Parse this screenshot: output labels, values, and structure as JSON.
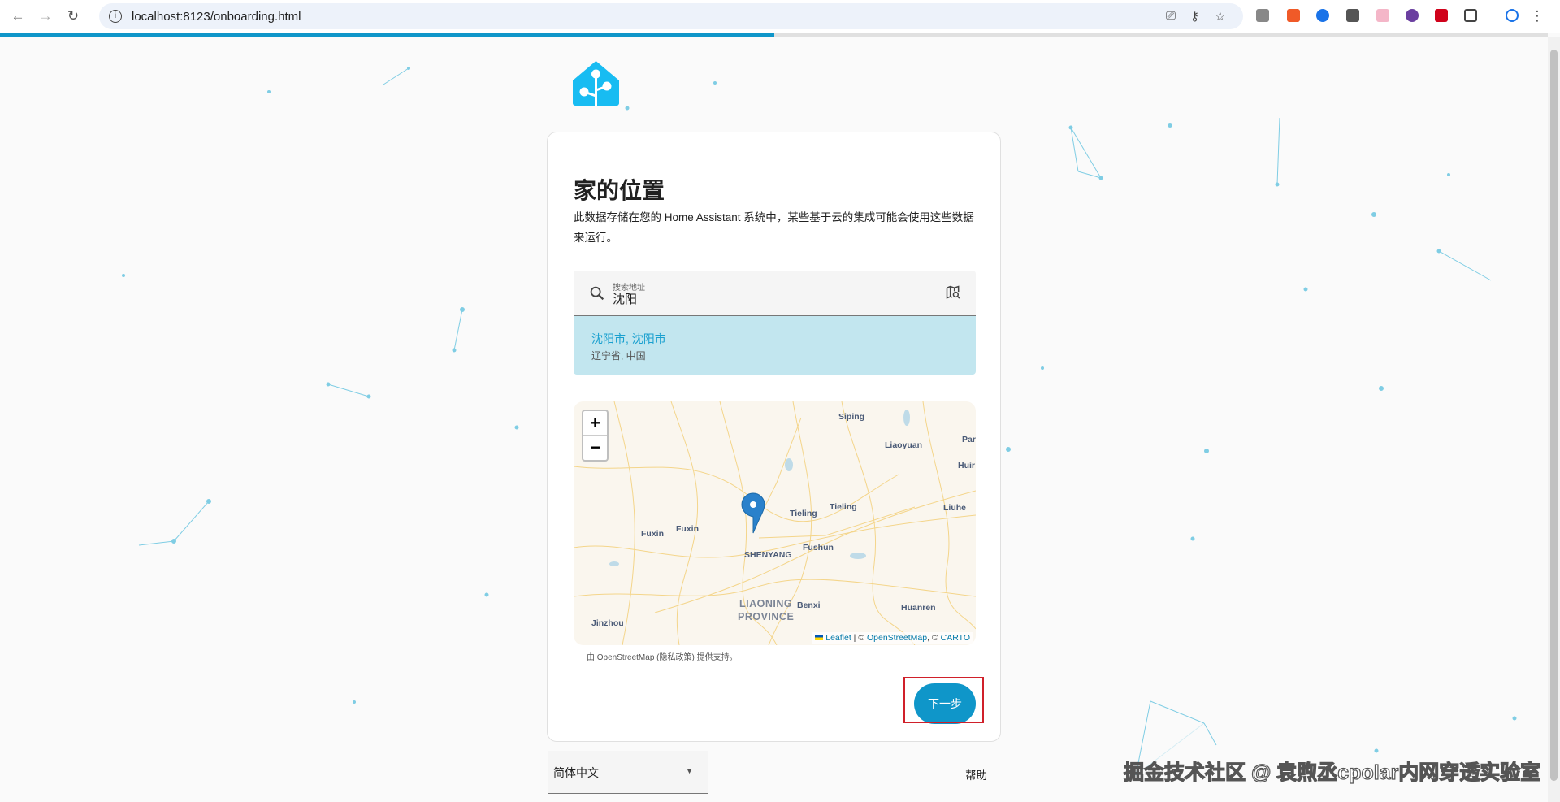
{
  "browser": {
    "url": "localhost:8123/onboarding.html",
    "extension_colors": [
      "#888888",
      "#f05a28",
      "#1a73e8",
      "#555555",
      "#f4b6c8",
      "#6b3fa0",
      "#d0021b",
      "#444444"
    ]
  },
  "progress": {
    "percent": 50,
    "color": "#0f96c9"
  },
  "card": {
    "title": "家的位置",
    "description": "此数据存储在您的 Home Assistant 系统中，某些基于云的集成可能会使用这些数据来运行。",
    "search": {
      "label": "搜索地址",
      "value": "沈阳"
    },
    "result": {
      "primary": "沈阳市, 沈阳市",
      "secondary": "辽宁省, 中国"
    },
    "map": {
      "zoom_in": "+",
      "zoom_out": "−",
      "labels": [
        "Siping",
        "Liaoyuan",
        "Par",
        "Huir",
        "Tieling",
        "Tieling",
        "Liuhe",
        "Fuxin",
        "Fuxin",
        "Fushun",
        "SHENYANG",
        "LIAONING",
        "PROVINCE",
        "Benxi",
        "Huanren",
        "Jinzhou"
      ],
      "attribution": {
        "leaflet": "Leaflet",
        "sep": " | © ",
        "osm": "OpenStreetMap",
        "sep2": ", © ",
        "carto": "CARTO"
      }
    },
    "credit": {
      "prefix": "由 ",
      "osm": "OpenStreetMap",
      "privacy": "隐私政策",
      "suffix": " 提供支持。"
    },
    "next_label": "下一步"
  },
  "footer": {
    "language": "简体中文",
    "help": "帮助"
  },
  "watermark": "掘金技术社区 @ 袁煦丞cpolar内网穿透实验室",
  "colors": {
    "accent": "#0f96c9",
    "logo": "#18bcf2",
    "highlight": "#d0202a"
  }
}
